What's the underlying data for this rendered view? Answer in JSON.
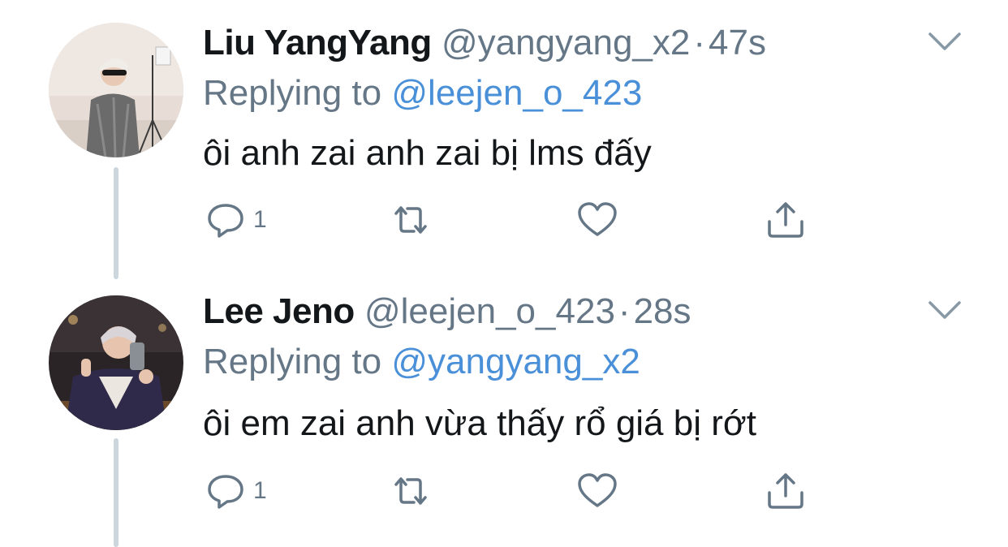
{
  "colors": {
    "text_primary": "#14171a",
    "text_secondary": "#657786",
    "mention_link": "#4a90d9",
    "thread_line": "#ccd6dd",
    "icon_gray": "#657786"
  },
  "tweets": [
    {
      "display_name": "Liu YangYang",
      "handle": "@yangyang_x2",
      "separator": "·",
      "time": "47s",
      "replying_prefix": "Replying to",
      "replying_to": "@leejen_o_423",
      "text": "ôi anh zai anh zai bị lms đấy",
      "reply_count": "1",
      "icons": [
        "reply-icon",
        "retweet-icon",
        "like-icon",
        "share-icon",
        "chevron-down-icon"
      ]
    },
    {
      "display_name": "Lee Jeno",
      "handle": "@leejen_o_423",
      "separator": "·",
      "time": "28s",
      "replying_prefix": "Replying to",
      "replying_to": "@yangyang_x2",
      "text": "ôi em zai anh vừa thấy rổ giá bị rớt",
      "reply_count": "1",
      "icons": [
        "reply-icon",
        "retweet-icon",
        "like-icon",
        "share-icon",
        "chevron-down-icon"
      ]
    }
  ]
}
